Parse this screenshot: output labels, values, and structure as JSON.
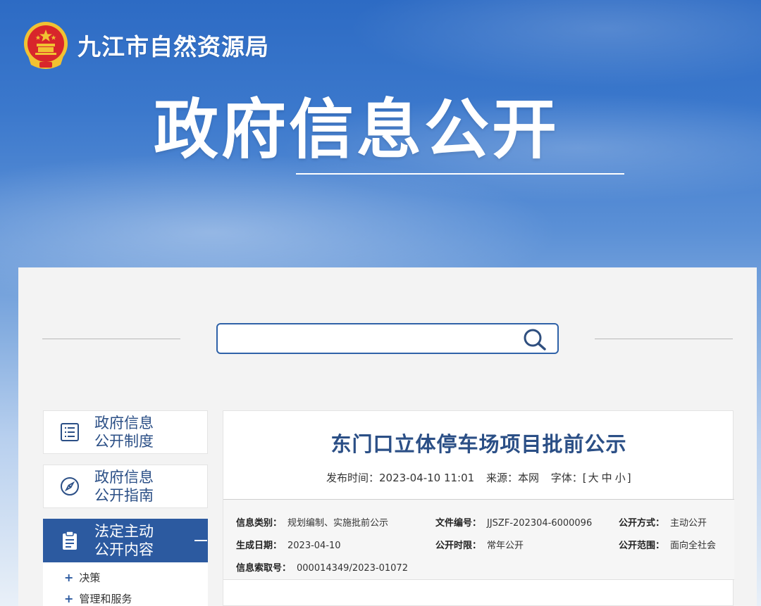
{
  "header": {
    "org_name": "九江市自然资源局",
    "hero_title": "政府信息公开"
  },
  "search": {
    "placeholder": "",
    "icon": "search-icon"
  },
  "sidebar": {
    "items": [
      {
        "label_line1": "政府信息",
        "label_line2": "公开制度",
        "icon": "list-icon"
      },
      {
        "label_line1": "政府信息",
        "label_line2": "公开指南",
        "icon": "compass-icon"
      },
      {
        "label_line1": "法定主动",
        "label_line2": "公开内容",
        "icon": "clipboard-icon",
        "active": true
      }
    ],
    "sub_items": [
      {
        "label": "决策"
      },
      {
        "label": "管理和服务"
      }
    ]
  },
  "article": {
    "title": "东门口立体停车场项目批前公示",
    "publish_label": "发布时间：",
    "publish_time": "2023-04-10 11:01",
    "source_label": "来源：",
    "source": "本网",
    "font_label": "字体：",
    "font_open": "[",
    "font_large": "大",
    "font_medium": "中",
    "font_small": "小",
    "font_close": "]",
    "info": {
      "category_label": "信息类别：",
      "category": "规划编制、实施批前公示",
      "doc_no_label": "文件编号：",
      "doc_no": "JJSZF-202304-6000096",
      "method_label": "公开方式：",
      "method": "主动公开",
      "date_label": "生成日期：",
      "date": "2023-04-10",
      "period_label": "公开时限：",
      "period": "常年公开",
      "scope_label": "公开范围：",
      "scope": "面向全社会",
      "index_label": "信息索取号：",
      "index": "000014349/2023-01072"
    }
  },
  "colors": {
    "primary": "#2c5aa0",
    "title_blue": "#2b4f86",
    "emblem_red": "#d8262b",
    "emblem_gold": "#f1c232"
  }
}
